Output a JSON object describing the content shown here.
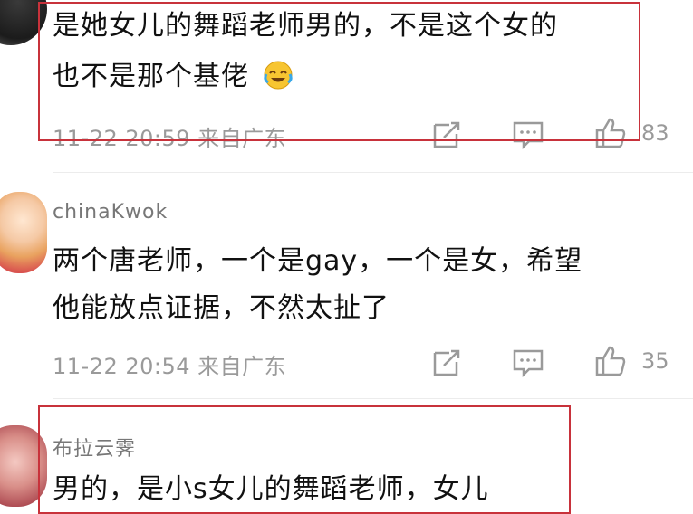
{
  "comments": [
    {
      "line1": "是她女儿的舞蹈老师男的，不是这个女的",
      "line2": "也不是那个基佬",
      "emoji": "laughing-crying-emoji",
      "meta": "11-22 20:59  来自广东",
      "likes": "83"
    },
    {
      "username": "chinaKwok",
      "line1": "两个唐老师，一个是gay，一个是女，希望",
      "line2": "他能放点证据，不然太扯了",
      "meta": "11-22 20:54  来自广东",
      "likes": "35"
    },
    {
      "username": "布拉云霁",
      "line1": "男的，是小s女儿的舞蹈老师，女儿"
    }
  ],
  "icons": {
    "share": "share-icon",
    "reply": "comment-icon",
    "like": "thumbs-up-icon"
  },
  "colors": {
    "highlight_box": "#c8323b",
    "meta_text": "#9a9a9a"
  }
}
